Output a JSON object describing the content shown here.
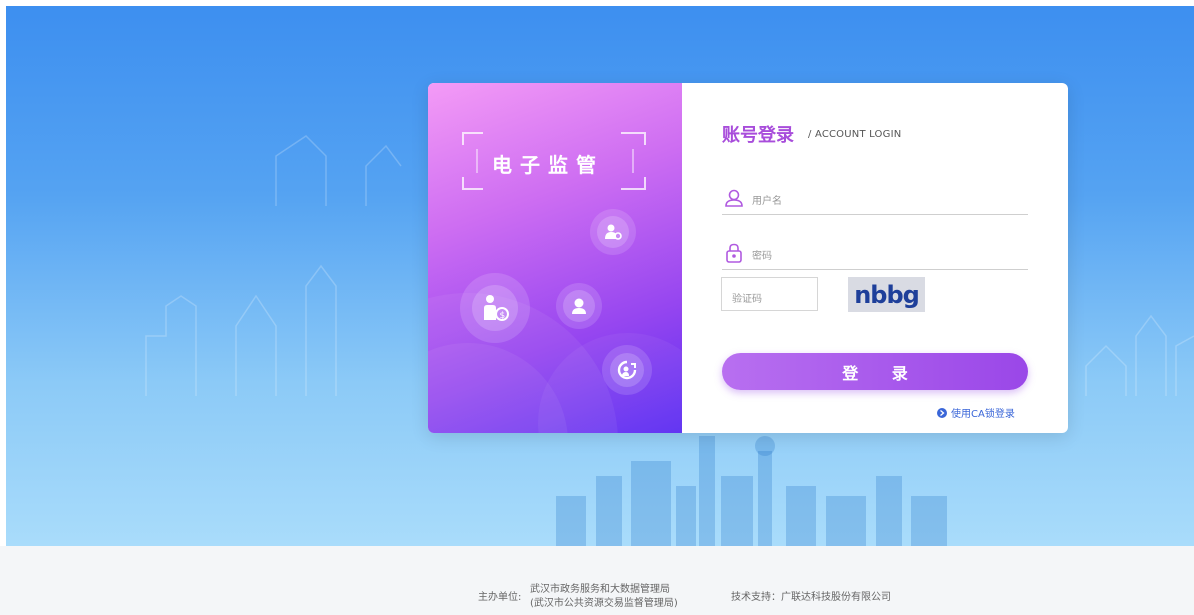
{
  "brand": {
    "title": "电子监管"
  },
  "login": {
    "title": "账号登录",
    "subtitle": "/ ACCOUNT LOGIN",
    "username_placeholder": "用户名",
    "password_placeholder": "密码",
    "captcha_placeholder": "验证码",
    "captcha_text": "nbbg",
    "submit_label": "登 录",
    "ca_link_label": "使用CA锁登录"
  },
  "footer": {
    "host_label": "主办单位:",
    "host_line1": "武汉市政务服务和大数据管理局",
    "host_line2": "(武汉市公共资源交易监督管理局)",
    "tech_support": "技术支持：广联达科技股份有限公司"
  },
  "icons": [
    "user-gear-icon",
    "user-money-icon",
    "user-icon",
    "user-growth-icon",
    "user-outline-icon",
    "lock-icon",
    "arrow-right-circle-icon"
  ],
  "colors": {
    "accent": "#a84ddb",
    "button": "#9a47e8",
    "link": "#3a66d8",
    "hero_top": "#3d8ff0",
    "hero_bottom": "#a9dcfb"
  }
}
